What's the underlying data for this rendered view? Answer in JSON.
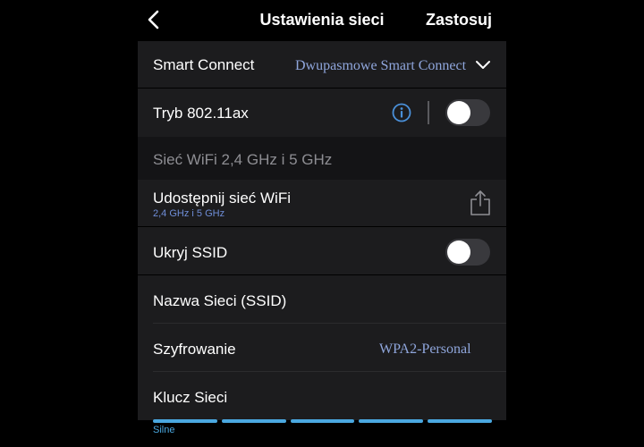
{
  "header": {
    "title": "Ustawienia sieci",
    "apply_label": "Zastosuj"
  },
  "smart_connect": {
    "label": "Smart Connect",
    "value": "Dwupasmowe Smart Connect"
  },
  "mode_80211ax": {
    "label": "Tryb 802.11ax",
    "enabled": false
  },
  "section": {
    "title": "Sieć WiFi 2,4 GHz i 5 GHz"
  },
  "share_wifi": {
    "label": "Udostępnij sieć WiFi",
    "sublabel": "2,4 GHz i 5 GHz"
  },
  "hide_ssid": {
    "label": "Ukryj SSID",
    "enabled": false
  },
  "ssid": {
    "label": "Nazwa Sieci (SSID)"
  },
  "encryption": {
    "label": "Szyfrowanie",
    "value": "WPA2-Personal"
  },
  "network_key": {
    "label": "Klucz Sieci"
  },
  "strength": {
    "label": "Silne",
    "level": 5,
    "max": 5,
    "color": "#4aa8e0"
  },
  "colors": {
    "background": "#000000",
    "panel": "#1c1c1e",
    "accent_value": "#8fa6dc",
    "info_icon": "#4a90d9"
  }
}
